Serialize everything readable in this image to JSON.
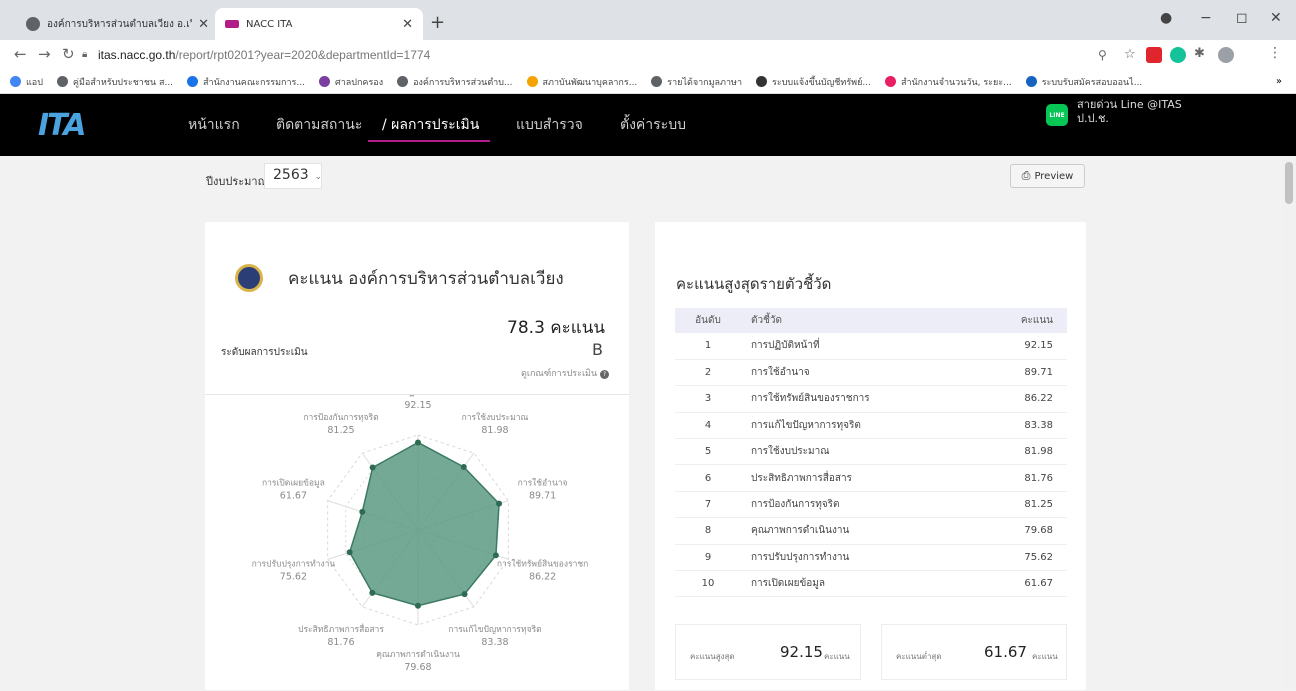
{
  "browser": {
    "tabs": [
      {
        "title": "องค์การบริหารส่วนตำบลเวียง อ.เวียงป่า",
        "active": false,
        "icon_color": "#5f6368"
      },
      {
        "title": "NACC ITA",
        "active": true,
        "icon_color": "#b31d8a"
      }
    ],
    "new_tab_label": "+",
    "window_controls": {
      "minimize": "−",
      "maximize": "◻",
      "close": "✕"
    },
    "url_host": "itas.nacc.go.th",
    "url_path": "/report/rpt0201?year=2020&departmentId=1774",
    "bookmarks": [
      {
        "label": "แอป",
        "color": "#4285f4"
      },
      {
        "label": "คู่มือสำหรับประชาชน ส...",
        "color": "#5f6368"
      },
      {
        "label": "สำนักงานคณะกรรมการ...",
        "color": "#1a73e8"
      },
      {
        "label": "ศาลปกครอง",
        "color": "#7b3fa0"
      },
      {
        "label": "องค์การบริหารส่วนตำบ...",
        "color": "#5f6368"
      },
      {
        "label": "สภาบันพัฒนาบุคลากร...",
        "color": "#f4a300"
      },
      {
        "label": "รายได้จากมูลภาษา",
        "color": "#5f6368"
      },
      {
        "label": "ระบบแจ้งขึ้นบัญชีทรัพย์...",
        "color": "#333333"
      },
      {
        "label": "สำนักงานจำนวนวัน, ระยะ...",
        "color": "#e91e63"
      },
      {
        "label": "ระบบรับสมัครสอบออนไ...",
        "color": "#1565c0"
      }
    ],
    "bookmarks_more": "»"
  },
  "nav": {
    "logo": "ITA",
    "items": [
      {
        "label": "หน้าแรก",
        "active": false
      },
      {
        "label": "ติดตามสถานะ",
        "active": false
      },
      {
        "label": "/ ผลการประเมิน",
        "active": true
      },
      {
        "label": "แบบสำรวจ",
        "active": false
      },
      {
        "label": "ตั้งค่าระบบ",
        "active": false
      }
    ],
    "line_badge": "LINE",
    "line_text_1": "สายด่วน  Line @ITAS",
    "line_text_2": "ป.ป.ช."
  },
  "filter": {
    "year_label": "ปีงบประมาณ",
    "year_value": "2563",
    "preview_label": "Preview"
  },
  "score_card": {
    "title": "คะแนน องค์การบริหารส่วนตำบลเวียง",
    "score": "78.3 คะแนน",
    "level_label": "ระดับผลการประเมิน",
    "level_value": "B",
    "criteria_link": "ดูเกณฑ์การประเมิน"
  },
  "chart_data": {
    "type": "radar",
    "max": 100,
    "series": [
      {
        "values": [
          92.15,
          81.98,
          89.71,
          86.22,
          83.38,
          79.68,
          81.76,
          75.62,
          61.67,
          81.25
        ],
        "color": "#5a9a82"
      }
    ],
    "categories": [
      "การปฏิบัติหน้าที่",
      "การใช้งบประมาณ",
      "การใช้อำนาจ",
      "การใช้ทรัพย์สินของราชก",
      "การแก้ไขปัญหาการทุจริต",
      "คุณภาพการดำเนินงาน",
      "ประสิทธิภาพการสื่อสาร",
      "การปรับปรุงการทำงาน",
      "การเปิดเผยข้อมูล",
      "การป้องกันการทุจริต"
    ],
    "value_labels": [
      "92.15",
      "81.98",
      "89.71",
      "86.22",
      "83.38",
      "79.68",
      "81.76",
      "75.62",
      "61.67",
      "81.25"
    ]
  },
  "ranking": {
    "title": "คะแนนสูงสุดรายตัวชี้วัด",
    "headers": {
      "rank": "อันดับ",
      "indicator": "ตัวชี้วัด",
      "score": "คะแนน"
    },
    "rows": [
      {
        "rank": "1",
        "indicator": "การปฏิบัติหน้าที่",
        "score": "92.15"
      },
      {
        "rank": "2",
        "indicator": "การใช้อำนาจ",
        "score": "89.71"
      },
      {
        "rank": "3",
        "indicator": "การใช้ทรัพย์สินของราชการ",
        "score": "86.22"
      },
      {
        "rank": "4",
        "indicator": "การแก้ไขปัญหาการทุจริต",
        "score": "83.38"
      },
      {
        "rank": "5",
        "indicator": "การใช้งบประมาณ",
        "score": "81.98"
      },
      {
        "rank": "6",
        "indicator": "ประสิทธิภาพการสื่อสาร",
        "score": "81.76"
      },
      {
        "rank": "7",
        "indicator": "การป้องกันการทุจริต",
        "score": "81.25"
      },
      {
        "rank": "8",
        "indicator": "คุณภาพการดำเนินงาน",
        "score": "79.68"
      },
      {
        "rank": "9",
        "indicator": "การปรับปรุงการทำงาน",
        "score": "75.62"
      },
      {
        "rank": "10",
        "indicator": "การเปิดเผยข้อมูล",
        "score": "61.67"
      }
    ],
    "max_label": "คะแนนสูงสุด",
    "max_value": "92.15",
    "min_label": "คะแนนต่ำสุด",
    "min_value": "61.67",
    "unit": "คะแนน"
  }
}
